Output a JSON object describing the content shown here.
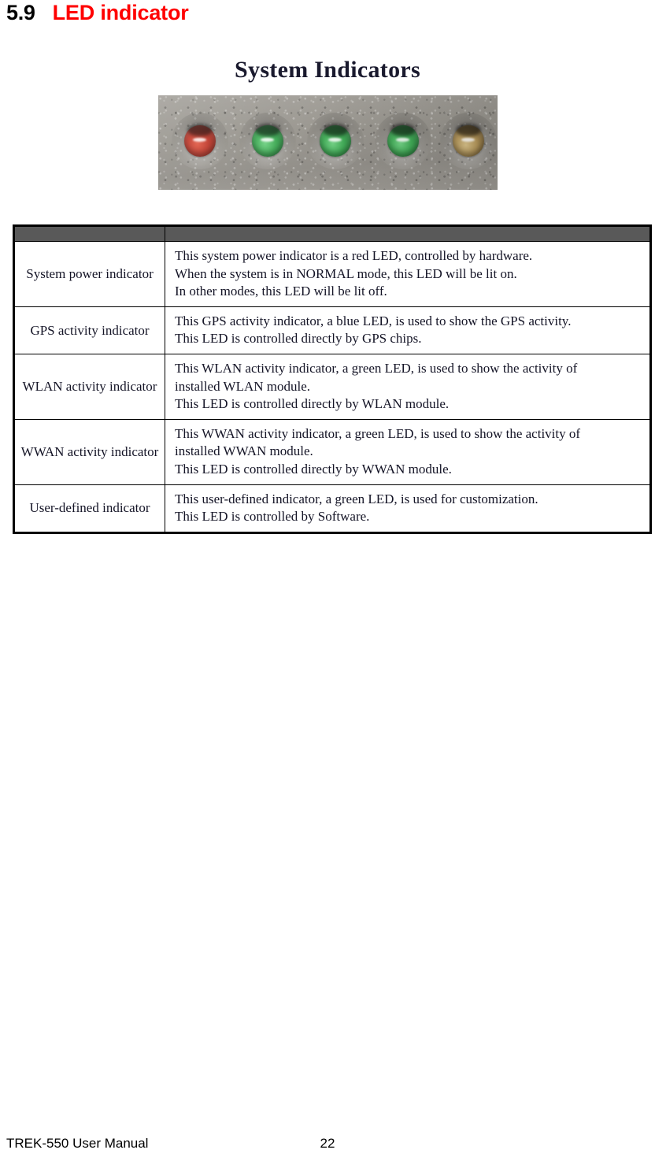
{
  "heading": {
    "number": "5.9",
    "title": "LED indicator",
    "title_color": "#ff0000"
  },
  "figure": {
    "caption": "System Indicators",
    "photo": {
      "panel_color": "#9b9893",
      "leds": [
        {
          "name": "system-power-led",
          "color_name": "red",
          "color": "#c0392b"
        },
        {
          "name": "gps-activity-led",
          "color_name": "green",
          "color": "#3faa55"
        },
        {
          "name": "wlan-activity-led",
          "color_name": "green",
          "color": "#3faa55"
        },
        {
          "name": "wwan-activity-led",
          "color_name": "green",
          "color": "#3faa55"
        },
        {
          "name": "user-defined-led",
          "color_name": "amber",
          "color": "#b89a5d"
        }
      ]
    }
  },
  "table": {
    "header_color": "#595959",
    "headers": [
      "",
      ""
    ],
    "rows": [
      {
        "name": "System power indicator",
        "desc_lines": [
          "This system power indicator is a red LED, controlled by hardware.",
          "When the system is in NORMAL mode, this LED will be lit on.",
          "In other modes, this LED will be lit off."
        ]
      },
      {
        "name": "GPS activity indicator",
        "desc_lines": [
          "This GPS activity indicator, a blue LED, is used to show the GPS activity.",
          "This LED is controlled directly by GPS chips."
        ]
      },
      {
        "name": "WLAN activity indicator",
        "desc_lines": [
          "This WLAN activity indicator, a green LED, is used to show the activity of",
          "installed WLAN module.",
          "This LED is controlled directly by WLAN module."
        ]
      },
      {
        "name": "WWAN activity indicator",
        "desc_lines": [
          "This WWAN activity indicator, a green LED, is used to show the activity of",
          "installed WWAN module.",
          "This LED is controlled directly by WWAN module."
        ]
      },
      {
        "name": "User-defined indicator",
        "desc_lines": [
          "This user-defined indicator, a green LED, is used for customization.",
          "This LED is controlled by Software."
        ]
      }
    ]
  },
  "footer": {
    "document_title": "TREK-550 User Manual",
    "page_number": "22"
  }
}
